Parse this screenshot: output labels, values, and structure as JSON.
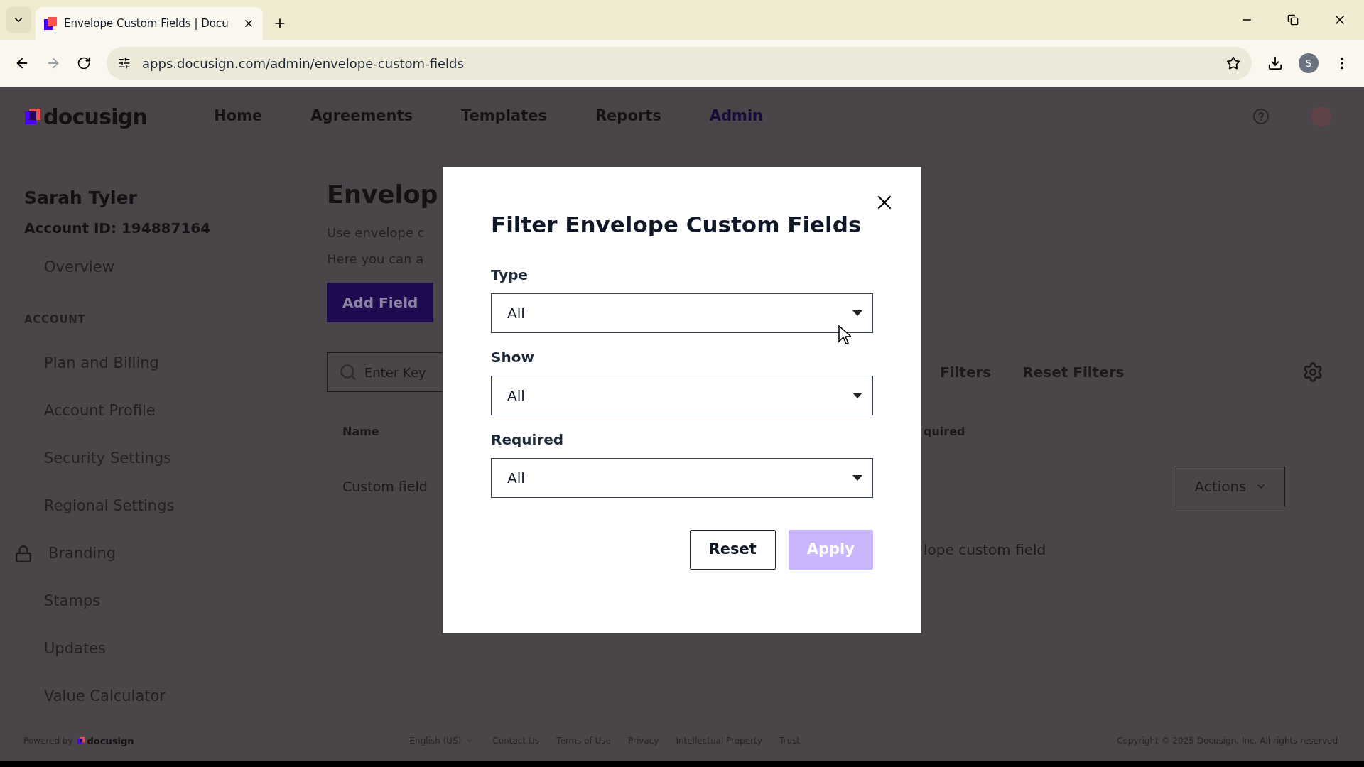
{
  "browser": {
    "tab_title": "Envelope Custom Fields | Docu",
    "url": "apps.docusign.com/admin/envelope-custom-fields",
    "profile_initial": "S"
  },
  "header": {
    "logo": "docusign",
    "nav": [
      {
        "label": "Home",
        "selected": false
      },
      {
        "label": "Agreements",
        "selected": false
      },
      {
        "label": "Templates",
        "selected": false
      },
      {
        "label": "Reports",
        "selected": false
      },
      {
        "label": "Admin",
        "selected": true
      }
    ]
  },
  "sidebar": {
    "user_name": "Sarah Tyler",
    "account_id": "Account ID: 194887164",
    "items": [
      {
        "kind": "link",
        "label": "Overview",
        "locked": false
      },
      {
        "kind": "heading",
        "label": "ACCOUNT"
      },
      {
        "kind": "link",
        "label": "Plan and Billing",
        "locked": false
      },
      {
        "kind": "link",
        "label": "Account Profile",
        "locked": false
      },
      {
        "kind": "link",
        "label": "Security Settings",
        "locked": false
      },
      {
        "kind": "link",
        "label": "Regional Settings",
        "locked": false
      },
      {
        "kind": "link",
        "label": "Branding",
        "locked": true
      },
      {
        "kind": "link",
        "label": "Stamps",
        "locked": false
      },
      {
        "kind": "link",
        "label": "Updates",
        "locked": false
      },
      {
        "kind": "link",
        "label": "Value Calculator",
        "locked": false
      }
    ]
  },
  "main": {
    "title": "Envelop",
    "description": [
      "Use envelope c",
      "Here you can a"
    ],
    "add_button": "Add Field",
    "search_placeholder": "Enter Key",
    "filters_link": "Filters",
    "reset_filters": "Reset Filters",
    "columns": [
      "Name",
      "quired"
    ],
    "rows": [
      {
        "cells": [
          "Custom field"
        ],
        "action": "Actions"
      },
      {
        "cells": [
          "",
          "lope custom field"
        ]
      }
    ]
  },
  "dialog": {
    "title": "Filter Envelope Custom Fields",
    "fields": [
      {
        "label": "Type",
        "value": "All"
      },
      {
        "label": "Show",
        "value": "All"
      },
      {
        "label": "Required",
        "value": "All"
      }
    ],
    "buttons": [
      {
        "label": "Reset",
        "kind": "secondary",
        "disabled": false
      },
      {
        "label": "Apply",
        "kind": "primary",
        "disabled": true
      }
    ]
  },
  "footer": {
    "powered_by": "Powered by",
    "logo": "docusign",
    "language": "English (US)",
    "links": [
      "Contact Us",
      "Terms of Use",
      "Privacy",
      "Intellectual Property",
      "Trust"
    ],
    "copyright": "Copyright © 2025 Docusign, Inc. All rights reserved"
  }
}
